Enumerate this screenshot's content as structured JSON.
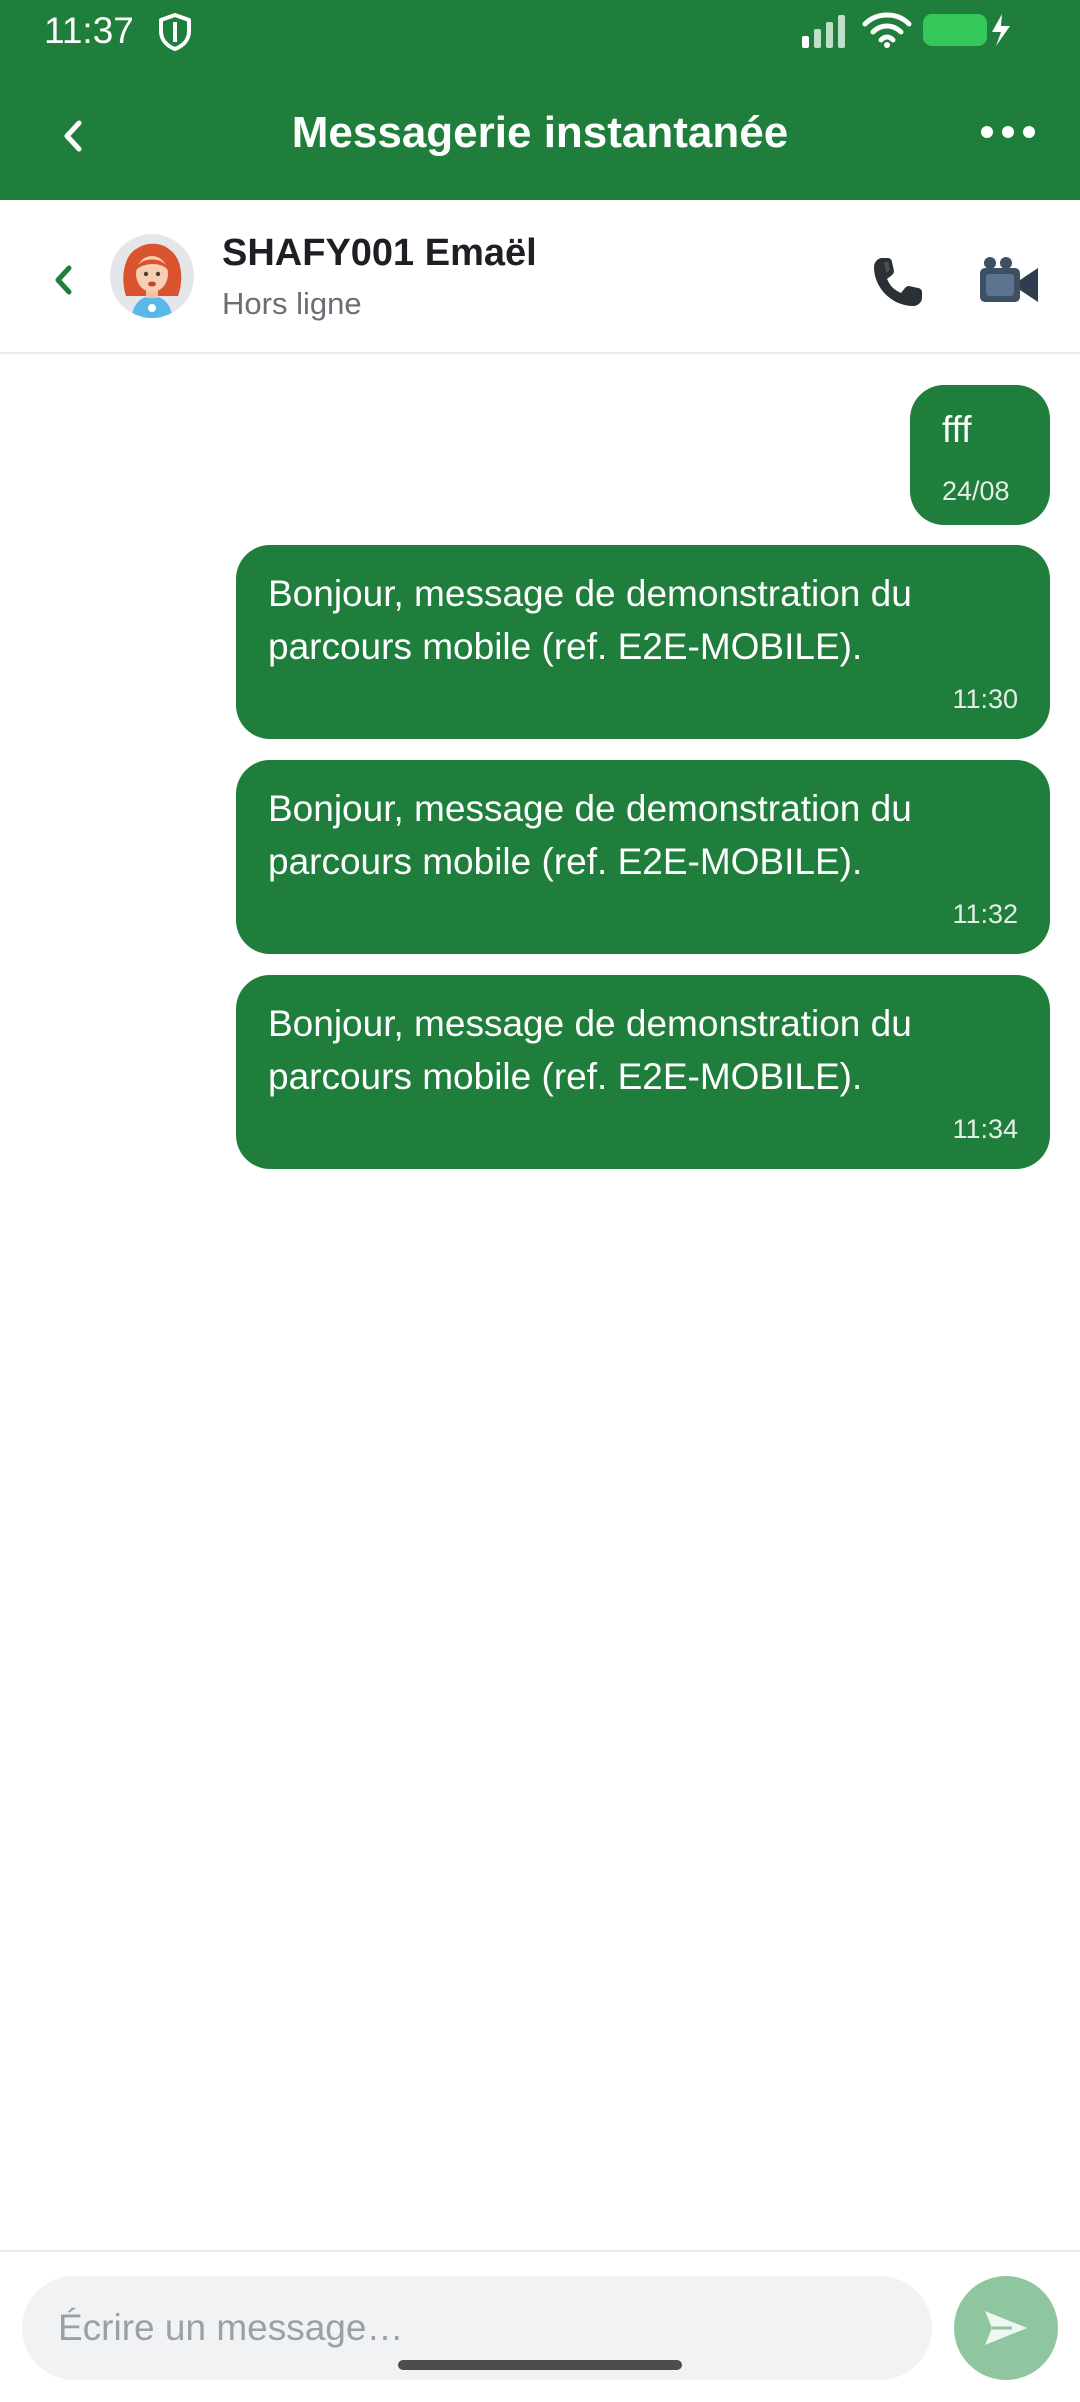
{
  "status_bar": {
    "time": "11:37",
    "shield_icon": "shield-icon",
    "signal_icon": "signal-icon",
    "wifi_icon": "wifi-icon",
    "battery_icon": "battery-charging-icon"
  },
  "app_bar": {
    "title": "Messagerie instantanée",
    "back_icon": "chevron-left-icon",
    "more_icon": "more-horizontal-icon"
  },
  "contact": {
    "name": "SHAFY001 Emaël",
    "status": "Hors ligne",
    "call_icon": "phone-icon",
    "video_icon": "video-camera-icon"
  },
  "messages": [
    {
      "text": "fff",
      "time": "24/08"
    },
    {
      "text": "Bonjour, message de demonstration du parcours mobile (ref. E2E-MOBILE).",
      "time": "11:30"
    },
    {
      "text": "Bonjour, message de demonstration du parcours mobile (ref. E2E-MOBILE).",
      "time": "11:32"
    },
    {
      "text": "Bonjour, message de demonstration du parcours mobile (ref. E2E-MOBILE).",
      "time": "11:34"
    }
  ],
  "composer": {
    "placeholder": "Écrire un message…",
    "value": "",
    "send_icon": "send-icon"
  },
  "colors": {
    "brand_green": "#1f7e3b",
    "send_disabled": "#8fc6a0",
    "battery_green": "#34c759"
  }
}
